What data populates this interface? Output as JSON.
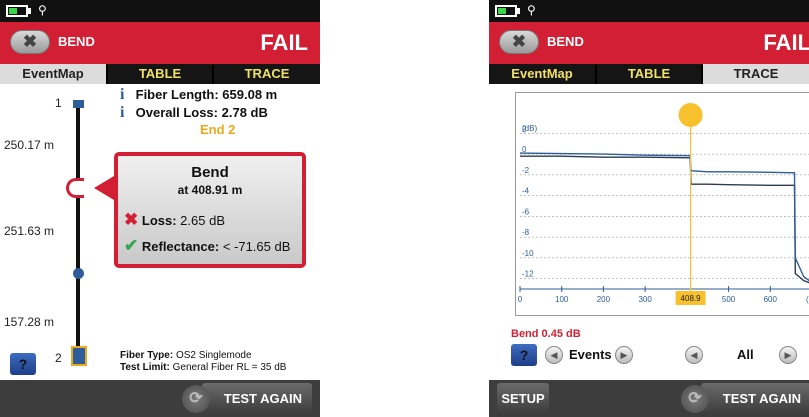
{
  "left": {
    "header": {
      "test_name": "BEND",
      "verdict": "FAIL"
    },
    "tabs": [
      {
        "label": "EventMap",
        "active": true
      },
      {
        "label": "TABLE",
        "active": false
      },
      {
        "label": "TRACE",
        "active": false
      }
    ],
    "summary": {
      "fiber_length_label": "Fiber Length:",
      "fiber_length_value": "659.08 m",
      "overall_loss_label": "Overall Loss:",
      "overall_loss_value": "2.78 dB",
      "end_label": "End 2"
    },
    "map": {
      "start_node": "1",
      "end_node": "2",
      "distances": [
        "250.17 m",
        "251.63 m",
        "157.28 m"
      ]
    },
    "popup": {
      "title": "Bend",
      "position": "at 408.91 m",
      "loss_label": "Loss:",
      "loss_value": "2.65 dB",
      "reflectance_label": "Reflectance:",
      "reflectance_value": "< -71.65 dB"
    },
    "fiber_info": {
      "type_label": "Fiber Type:",
      "type_value": "OS2 Singlemode",
      "limit_label": "Test Limit:",
      "limit_value": "General Fiber RL = 35 dB"
    },
    "footer": {
      "help": "?",
      "test_again": "TEST AGAIN"
    }
  },
  "right": {
    "header": {
      "test_name": "BEND",
      "verdict": "FAIL"
    },
    "tabs": [
      {
        "label": "EventMap",
        "active": false
      },
      {
        "label": "TABLE",
        "active": false
      },
      {
        "label": "TRACE",
        "active": true
      }
    ],
    "trace": {
      "y_unit": "(dB)",
      "x_unit": "(m",
      "cursor_label": "408.9",
      "bend_readout": "Bend 0.45 dB"
    },
    "chart_data": {
      "type": "line",
      "title": "",
      "xlabel": "(m",
      "ylabel": "(dB)",
      "xlim": [
        0,
        700
      ],
      "ylim": [
        -13,
        3
      ],
      "x_ticks": [
        0,
        100,
        200,
        300,
        500,
        600
      ],
      "y_ticks": [
        2,
        0,
        -2,
        -4,
        -6,
        -8,
        -10,
        -12
      ],
      "grid": true,
      "cursor_x": 408.9,
      "series": [
        {
          "x": [
            0,
            100,
            200,
            300,
            408,
            410,
            450,
            500,
            600,
            658,
            660,
            680,
            700
          ],
          "y": [
            -0.2,
            -0.2,
            -0.3,
            -0.3,
            -0.35,
            -2.9,
            -2.9,
            -2.95,
            -3.0,
            -3.0,
            -11.5,
            -12.2,
            -12.5
          ]
        },
        {
          "x": [
            0,
            100,
            200,
            300,
            408,
            410,
            450,
            500,
            600,
            658,
            660,
            680,
            700
          ],
          "y": [
            0.1,
            0.05,
            0.0,
            -0.1,
            -0.15,
            -1.6,
            -1.7,
            -1.7,
            -1.75,
            -1.8,
            -10.0,
            -11.8,
            -12.4
          ]
        }
      ]
    },
    "nav": {
      "events_label": "Events",
      "all_label": "All"
    },
    "footer": {
      "help": "?",
      "setup": "SETUP",
      "test_again": "TEST AGAIN"
    }
  },
  "colors": {
    "header_red": "#d21f34",
    "accent_blue": "#2d5d9a",
    "tab_text": "#f0e06a",
    "end_orange": "#e8a91b",
    "cursor_yellow": "#f6c12c"
  },
  "icons": {
    "back": "x-pill-icon",
    "info": "info-icon",
    "fail": "x-mark-icon",
    "pass": "check-mark-icon",
    "refresh": "refresh-icon",
    "prev": "chevron-left-icon",
    "next": "chevron-right-icon"
  }
}
